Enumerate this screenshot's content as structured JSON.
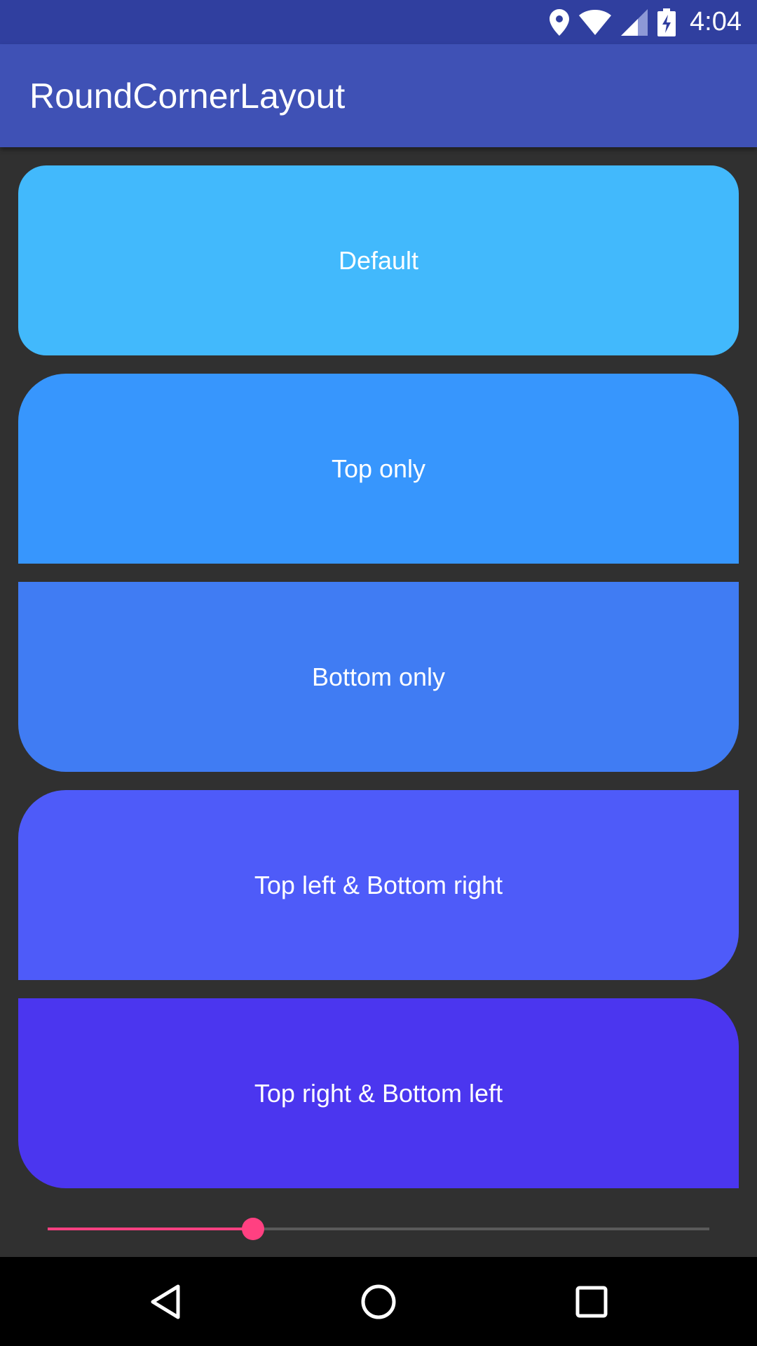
{
  "status_bar": {
    "time": "4:04",
    "icons": [
      "location-icon",
      "wifi-icon",
      "signal-icon",
      "battery-charging-icon"
    ]
  },
  "app_bar": {
    "title": "RoundCornerLayout",
    "color": "#3F51B5"
  },
  "cards": [
    {
      "label": "Default",
      "color": "#42B9FC",
      "corners": "all"
    },
    {
      "label": "Top only",
      "color": "#3796FD",
      "corners": "top"
    },
    {
      "label": "Bottom only",
      "color": "#407CF3",
      "corners": "bottom"
    },
    {
      "label": "Top left & Bottom right",
      "color": "#4E5BF9",
      "corners": "top-left-bottom-right"
    },
    {
      "label": "Top right & Bottom left",
      "color": "#4B36EF",
      "corners": "top-right-bottom-left"
    }
  ],
  "slider": {
    "value_fraction": 0.31,
    "accent_color": "#FF4081"
  },
  "nav_bar": {
    "buttons": [
      "back-icon",
      "home-icon",
      "recents-icon"
    ]
  }
}
